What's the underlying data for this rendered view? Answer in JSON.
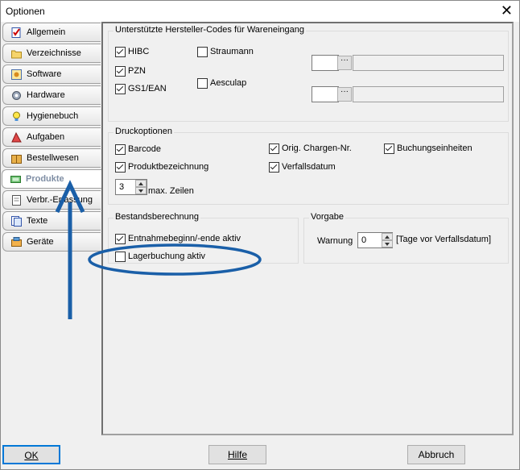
{
  "window": {
    "title": "Optionen",
    "close_glyph": "✕"
  },
  "tabs": [
    {
      "label": "Allgemein",
      "icon": "checklist-icon"
    },
    {
      "label": "Verzeichnisse",
      "icon": "folder-icon"
    },
    {
      "label": "Software",
      "icon": "software-icon"
    },
    {
      "label": "Hardware",
      "icon": "gear-icon"
    },
    {
      "label": "Hygienebuch",
      "icon": "lightbulb-icon"
    },
    {
      "label": "Aufgaben",
      "icon": "tasks-icon"
    },
    {
      "label": "Bestellwesen",
      "icon": "package-icon"
    },
    {
      "label": "Produkte",
      "icon": "product-icon"
    },
    {
      "label": "Verbr.-Erfassung",
      "icon": "document-icon"
    },
    {
      "label": "Texte",
      "icon": "texts-icon"
    },
    {
      "label": "Geräte",
      "icon": "devices-icon"
    }
  ],
  "hersteller": {
    "title": "Unterstützte Hersteller-Codes für Wareneingang",
    "hibc": "HIBC",
    "pzn": "PZN",
    "gs1": "GS1/EAN",
    "straumann": "Straumann",
    "aesculap": "Aesculap",
    "browse_label": "···"
  },
  "druck": {
    "title": "Druckoptionen",
    "barcode": "Barcode",
    "produktbezeichnung": "Produktbezeichnung",
    "orig_chargen": "Orig. Chargen-Nr.",
    "verfallsdatum": "Verfallsdatum",
    "buchungseinheiten": "Buchungseinheiten",
    "max_zeilen_value": "3",
    "max_zeilen_label": "max. Zeilen"
  },
  "bestand": {
    "title": "Bestandsberechnung",
    "entnahme": "Entnahmebeginn/-ende aktiv",
    "lagerbuchung": "Lagerbuchung aktiv"
  },
  "vorgabe": {
    "title": "Vorgabe",
    "warnung_label": "Warnung",
    "warnung_value": "0",
    "unit": "[Tage vor Verfallsdatum]"
  },
  "buttons": {
    "ok": "OK",
    "hilfe": "Hilfe",
    "abbruch": "Abbruch"
  },
  "annotation_color": "#1a5fa8"
}
